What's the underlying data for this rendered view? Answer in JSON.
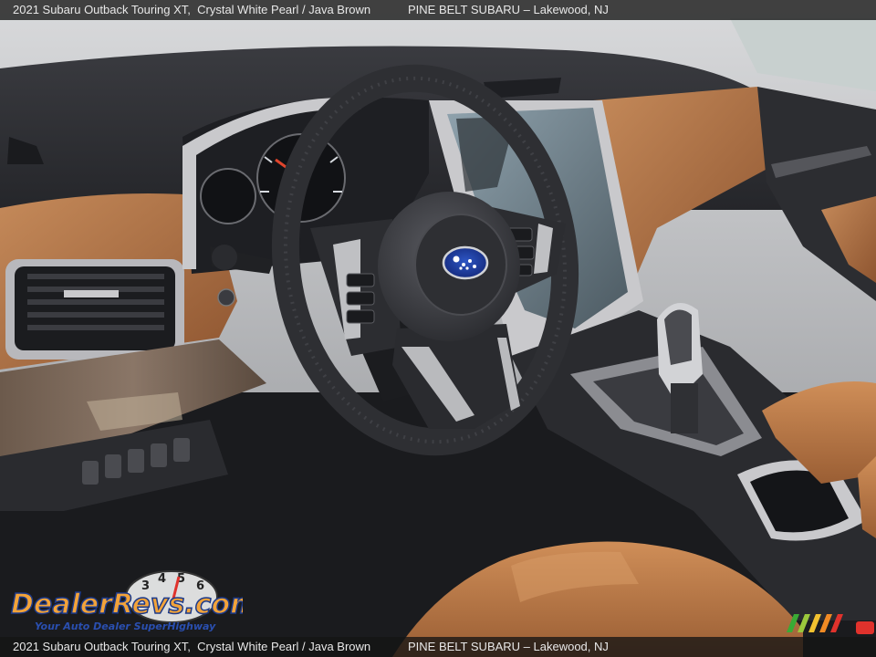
{
  "caption": {
    "vehicle": "2021 Subaru Outback Touring XT,",
    "color": "Crystal White Pearl / Java Brown",
    "dealer": "PINE BELT SUBARU – Lakewood, NJ"
  },
  "watermark": {
    "brand": "DealerRevs.com",
    "tagline": "Your Auto Dealer SuperHighway",
    "gauge_digits": [
      "3",
      "4",
      "5",
      "6"
    ]
  },
  "colors": {
    "java_brown": "#a86a3e",
    "dash_dark": "#2b2c30",
    "leather_tan": "#b8794a",
    "subaru_blue": "#1f3e9a",
    "silver_trim": "#c9c9cc"
  }
}
